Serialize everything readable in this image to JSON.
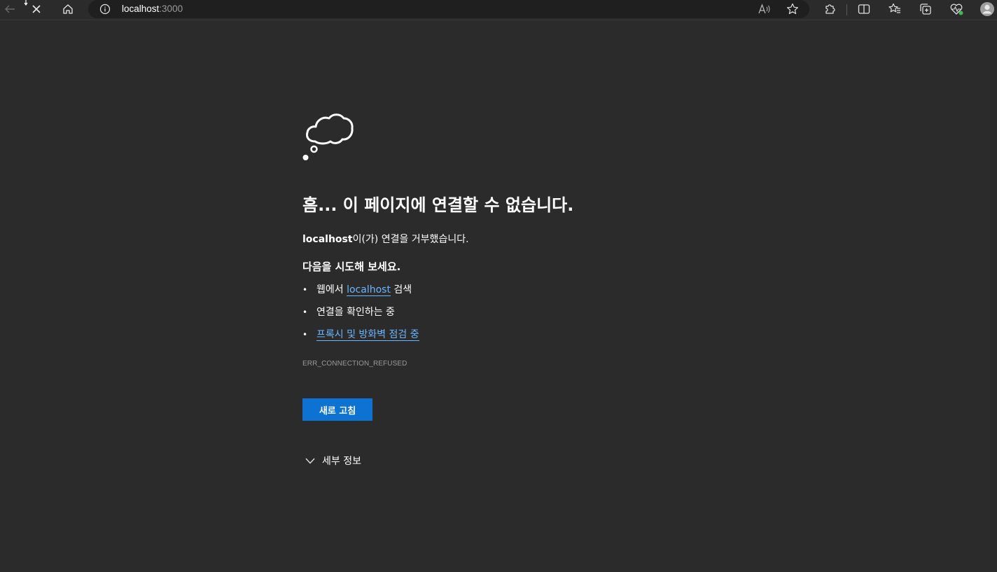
{
  "browser": {
    "address": {
      "host": "localhost",
      "port": ":3000"
    },
    "toolbar_icons": [
      "back-icon",
      "stop-icon",
      "home-icon",
      "info-icon",
      "read-aloud-icon",
      "favorite-star-icon",
      "extensions-icon",
      "split-screen-icon",
      "favorites-icon",
      "collections-icon",
      "browser-essentials-icon",
      "profile-avatar-icon"
    ]
  },
  "error_page": {
    "icon": "thought-cloud-icon",
    "title": "흠... 이 페이지에 연결할 수 없습니다.",
    "refused_host": "localhost",
    "refused_message": "이(가) 연결을 거부했습니다.",
    "try_heading": "다음을 시도해 보세요.",
    "suggestions": {
      "search_prefix": "웹에서 ",
      "search_link": "localhost",
      "search_suffix": " 검색",
      "check_connection": "연결을 확인하는 중",
      "proxy_firewall": "프록시 및 방화벽 점검 중"
    },
    "error_code": "ERR_CONNECTION_REFUSED",
    "refresh_button": "새로 고침",
    "details_label": "세부 정보"
  },
  "colors": {
    "background": "#2b2b2b",
    "address_bar": "#1f1f1f",
    "link": "#6cb6ff",
    "primary_button": "#0e72d2",
    "muted_text": "#9a9a9a"
  }
}
